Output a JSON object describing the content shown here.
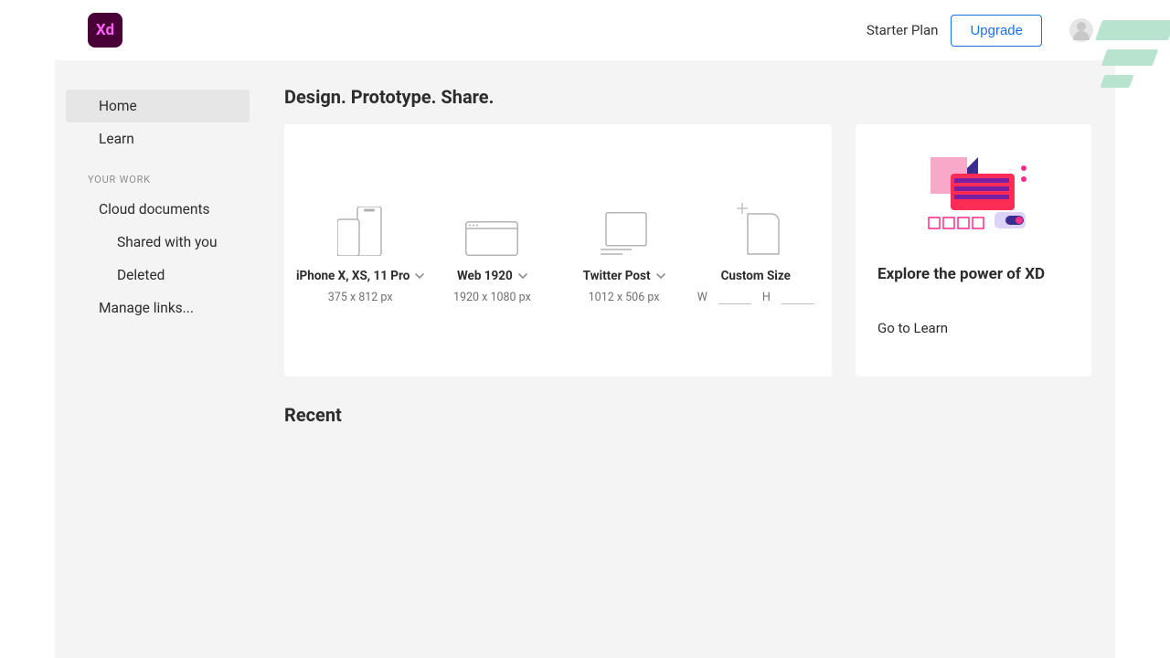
{
  "header": {
    "logo_text": "Xd",
    "plan_label": "Starter Plan",
    "upgrade_label": "Upgrade"
  },
  "sidebar": {
    "items": [
      {
        "label": "Home",
        "active": true
      },
      {
        "label": "Learn",
        "active": false
      }
    ],
    "section_label": "YOUR WORK",
    "work_items": [
      {
        "label": "Cloud documents"
      },
      {
        "label": "Shared with you",
        "sub": true
      },
      {
        "label": "Deleted",
        "sub": true
      },
      {
        "label": "Manage links..."
      }
    ]
  },
  "main": {
    "tagline": "Design. Prototype. Share.",
    "presets": [
      {
        "label": "iPhone X, XS, 11 Pro",
        "dims": "375 x 812 px",
        "icon": "phone"
      },
      {
        "label": "Web 1920",
        "dims": "1920 x 1080 px",
        "icon": "web"
      },
      {
        "label": "Twitter Post",
        "dims": "1012 x 506 px",
        "icon": "post"
      }
    ],
    "custom": {
      "label": "Custom Size",
      "w_label": "W",
      "h_label": "H"
    },
    "recent_title": "Recent"
  },
  "promo": {
    "title": "Explore the power of XD",
    "link": "Go to Learn"
  }
}
